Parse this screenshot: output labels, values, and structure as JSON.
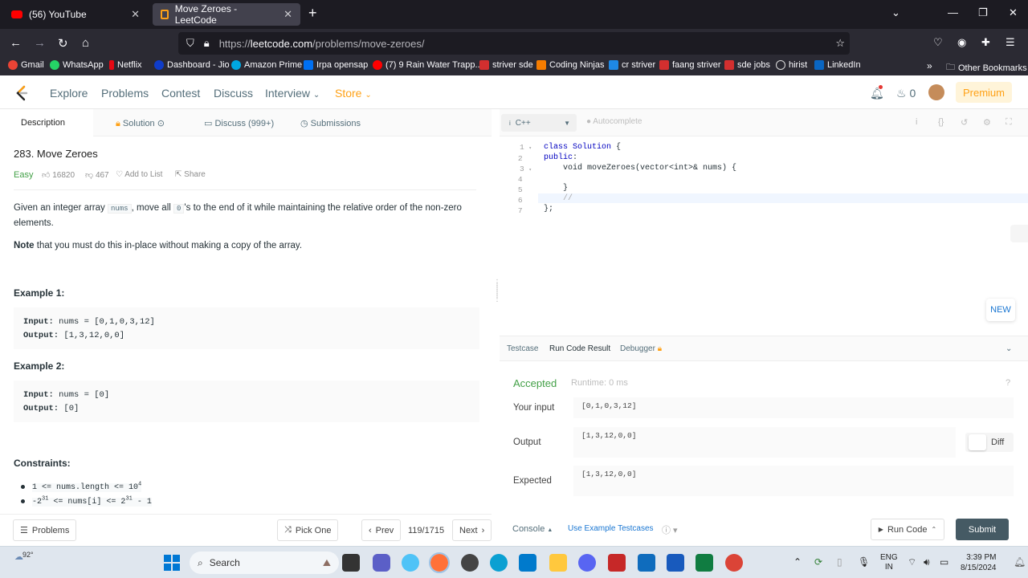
{
  "browser": {
    "tabs": [
      {
        "label": "(56) YouTube"
      },
      {
        "label": "Move Zeroes - LeetCode"
      }
    ],
    "url_prefix": "https://",
    "url_host": "leetcode.com",
    "url_path": "/problems/move-zeroes/",
    "downloads_count": "0",
    "bookmarks": [
      {
        "label": "Gmail",
        "color": "#ea4335"
      },
      {
        "label": "WhatsApp",
        "color": "#25d366"
      },
      {
        "label": "Netflix",
        "color": "#e50914"
      },
      {
        "label": "Dashboard - Jio",
        "color": "#0f3cc9"
      },
      {
        "label": "Amazon Prime",
        "color": "#00a8e1"
      },
      {
        "label": "Irpa opensap",
        "color": "#0070f2"
      },
      {
        "label": "(7) 9 Rain Water Trapp...",
        "color": "#ff0000"
      },
      {
        "label": "striver sde",
        "color": "#d32f2f"
      },
      {
        "label": "Coding Ninjas",
        "color": "#f57c00"
      },
      {
        "label": "cr striver",
        "color": "#1e88e5"
      },
      {
        "label": "faang striver",
        "color": "#d32f2f"
      },
      {
        "label": "sde jobs",
        "color": "#d32f2f"
      },
      {
        "label": "hirist",
        "color": "#555555"
      },
      {
        "label": "LinkedIn",
        "color": "#0a66c2"
      }
    ],
    "other_bookmarks": "Other Bookmarks"
  },
  "header": {
    "nav": [
      "Explore",
      "Problems",
      "Contest",
      "Discuss",
      "Interview",
      "Store"
    ],
    "notif_count": "0",
    "premium": "Premium"
  },
  "left_tabs": {
    "description": "Description",
    "solution": "Solution",
    "discuss": "Discuss (999+)",
    "submissions": "Submissions"
  },
  "problem": {
    "title": "283. Move Zeroes",
    "difficulty": "Easy",
    "likes": "16820",
    "dislikes": "467",
    "add_to_list": "Add to List",
    "share": "Share",
    "desc_1": "Given an integer array ",
    "desc_code": "nums",
    "desc_2": ", move all ",
    "desc_zero": "0",
    "desc_3": "'s to the end of it while maintaining the relative order of the non-zero elements.",
    "note_bold": "Note",
    "note_rest": " that you must do this in-place without making a copy of the array.",
    "example1_title": "Example 1:",
    "example1_input_label": "Input:",
    "example1_input": "nums = [0,1,0,3,12]",
    "example1_output_label": "Output:",
    "example1_output": "[1,3,12,0,0]",
    "example2_title": "Example 2:",
    "example2_input_label": "Input:",
    "example2_input": "nums = [0]",
    "example2_output_label": "Output:",
    "example2_output": "[0]",
    "constraints_title": "Constraints:",
    "constraint1_pre": "1 <= nums.length <= 10",
    "constraint1_sup": "4",
    "constraint2_a": "-2",
    "constraint2_sup1": "31",
    "constraint2_b": " <= nums[i] <= 2",
    "constraint2_sup2": "31",
    "constraint2_c": " - 1"
  },
  "left_footer": {
    "problems": "Problems",
    "pick_one": "Pick One",
    "prev": "Prev",
    "page": "119/1715",
    "next": "Next"
  },
  "editor": {
    "language": "C++",
    "autocomplete": "Autocomplete",
    "line_numbers": [
      "1",
      "2",
      "3",
      "4",
      "5",
      "6",
      "7"
    ],
    "new_badge": "NEW"
  },
  "result_tabs": {
    "testcase": "Testcase",
    "run_code_result": "Run Code Result",
    "debugger": "Debugger"
  },
  "result": {
    "status": "Accepted",
    "runtime": "Runtime: 0 ms",
    "your_input_label": "Your input",
    "your_input": "[0,1,0,3,12]",
    "output_label": "Output",
    "output": "[1,3,12,0,0]",
    "expected_label": "Expected",
    "expected": "[1,3,12,0,0]",
    "diff": "Diff"
  },
  "right_footer": {
    "console": "Console",
    "use_example": "Use Example Testcases",
    "run_code": "Run Code",
    "submit": "Submit"
  },
  "taskbar": {
    "weather": "92°",
    "search": "Search",
    "lang1": "ENG",
    "lang2": "IN",
    "time": "3:39 PM",
    "date": "8/15/2024"
  }
}
